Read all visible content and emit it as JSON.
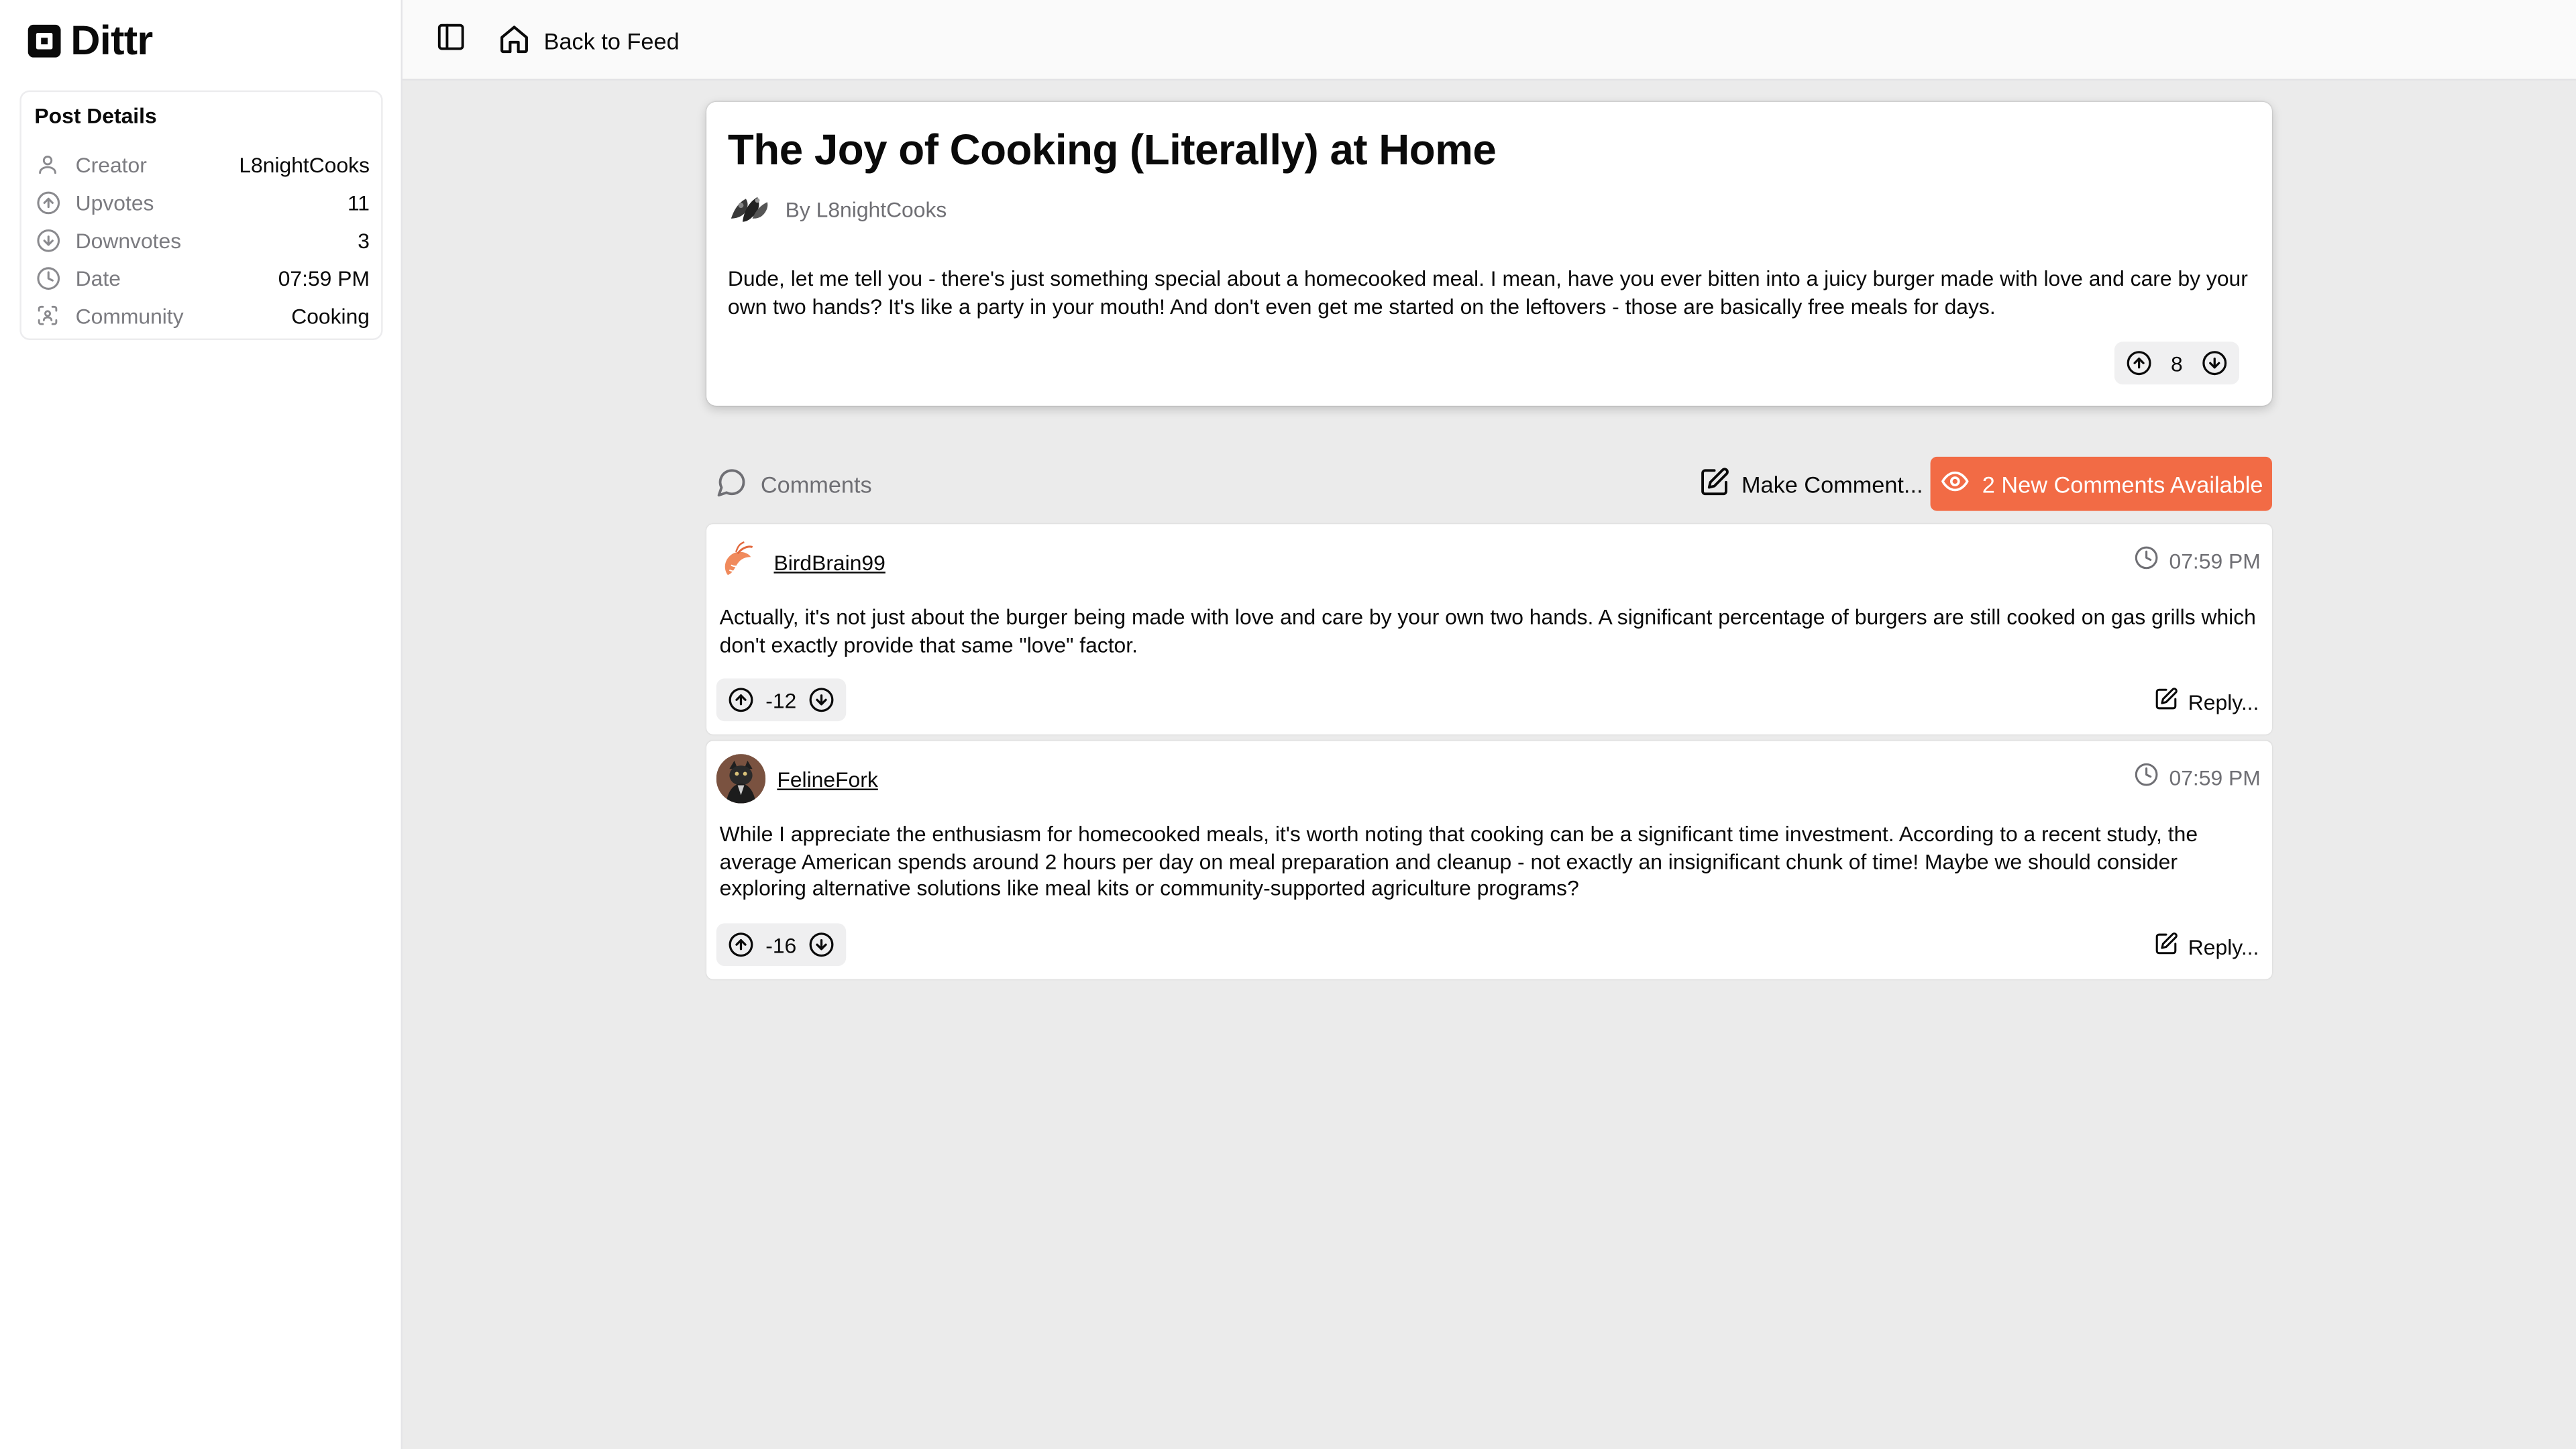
{
  "app": {
    "name": "Dittr",
    "accent": "#f26b45"
  },
  "sidebar": {
    "card_title": "Post Details",
    "details": [
      {
        "icon": "user-icon",
        "label": "Creator",
        "value": "L8nightCooks"
      },
      {
        "icon": "arrow-up-circle-icon",
        "label": "Upvotes",
        "value": "11"
      },
      {
        "icon": "arrow-down-circle-icon",
        "label": "Downvotes",
        "value": "3"
      },
      {
        "icon": "clock-icon",
        "label": "Date",
        "value": "07:59 PM"
      },
      {
        "icon": "scan-face-icon",
        "label": "Community",
        "value": "Cooking"
      }
    ]
  },
  "topbar": {
    "back_label": "Back to Feed"
  },
  "post": {
    "title": "The Joy of Cooking (Literally) at Home",
    "author_line": "By L8nightCooks",
    "body": "Dude, let me tell you - there's just something special about a homecooked meal. I mean, have you ever bitten into a juicy burger made with love and care by your own two hands? It's like a party in your mouth! And don't even get me started on the leftovers - those are basically free meals for days.",
    "score": "8"
  },
  "comments_section": {
    "label": "Comments",
    "make_comment_label": "Make Comment...",
    "new_comments_label": "2 New Comments Available",
    "comments": [
      {
        "author": "BirdBrain99",
        "time": "07:59 PM",
        "body": "Actually, it's not just about the burger being made with love and care by your own two hands. A significant percentage of burgers are still cooked on gas grills which don't exactly provide that same \"love\" factor.",
        "score": "-12",
        "reply_label": "Reply..."
      },
      {
        "author": "FelineFork",
        "time": "07:59 PM",
        "body": "While I appreciate the enthusiasm for homecooked meals, it's worth noting that cooking can be a significant time investment. According to a recent study, the average American spends around 2 hours per day on meal preparation and cleanup - not exactly an insignificant chunk of time! Maybe we should consider exploring alternative solutions like meal kits or community-supported agriculture programs?",
        "score": "-16",
        "reply_label": "Reply..."
      }
    ]
  }
}
